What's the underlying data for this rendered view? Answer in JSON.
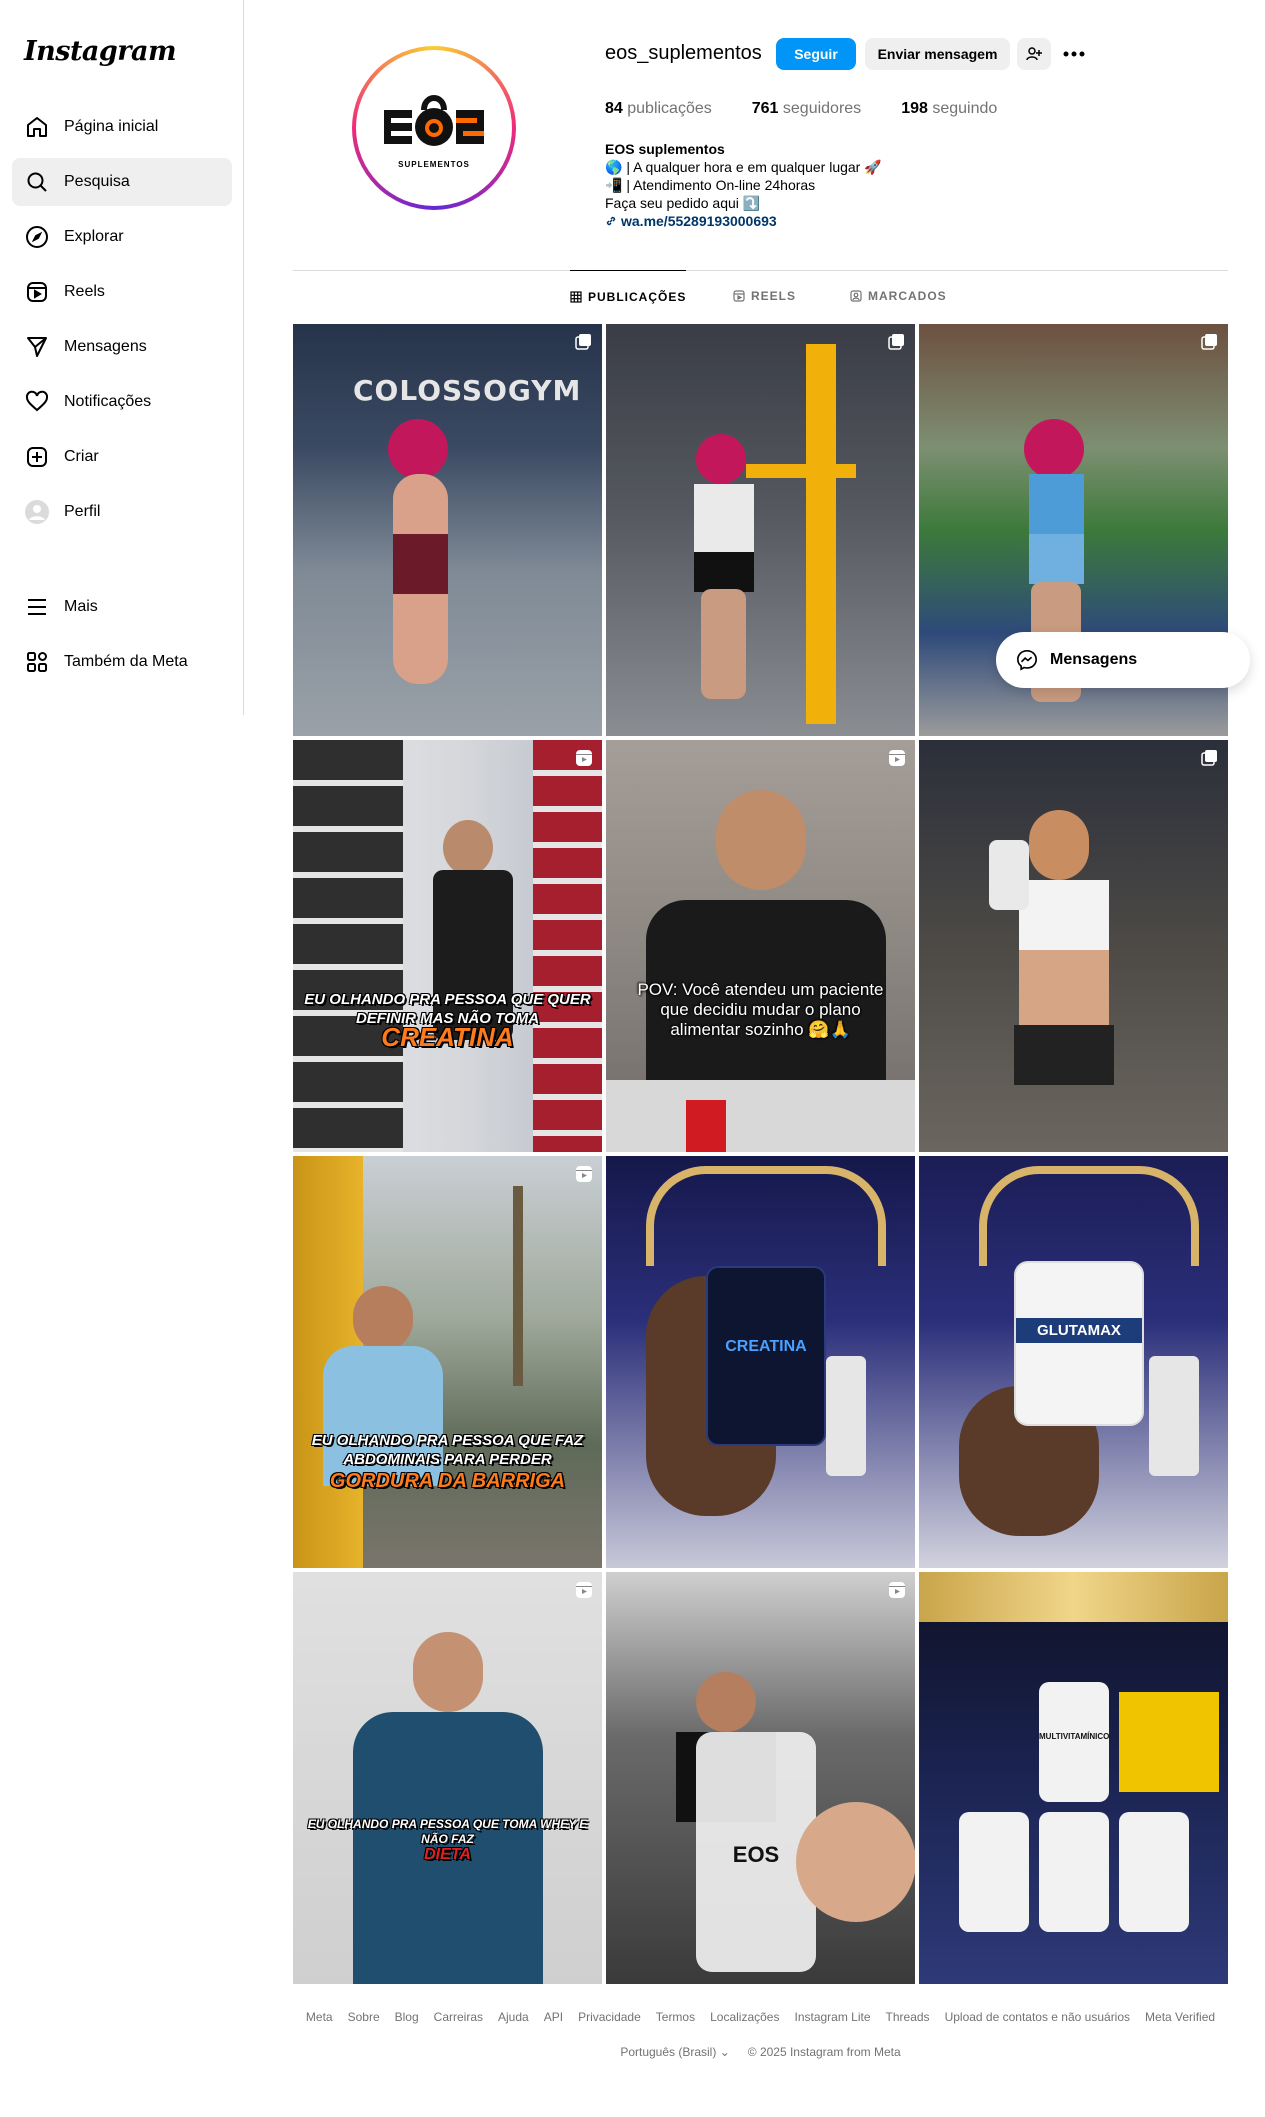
{
  "app": {
    "logo": "Instagram"
  },
  "sidebar": {
    "items": [
      {
        "label": "Página inicial",
        "icon": "home-icon"
      },
      {
        "label": "Pesquisa",
        "icon": "search-icon",
        "active": true
      },
      {
        "label": "Explorar",
        "icon": "compass-icon"
      },
      {
        "label": "Reels",
        "icon": "reels-icon"
      },
      {
        "label": "Mensagens",
        "icon": "send-icon"
      },
      {
        "label": "Notificações",
        "icon": "heart-icon"
      },
      {
        "label": "Criar",
        "icon": "plus-square-icon"
      },
      {
        "label": "Perfil",
        "icon": "avatar-icon"
      }
    ],
    "more": [
      {
        "label": "Mais",
        "icon": "menu-icon"
      },
      {
        "label": "Também da Meta",
        "icon": "meta-apps-icon"
      }
    ]
  },
  "profile": {
    "username": "eos_suplementos",
    "follow_label": "Seguir",
    "message_label": "Enviar mensagem",
    "avatar_brand": "EOS",
    "avatar_tagline": "SUPLEMENTOS",
    "stats": {
      "posts_count": "84",
      "posts_label": "publicações",
      "followers_count": "761",
      "followers_label": "seguidores",
      "following_count": "198",
      "following_label": "seguindo"
    },
    "bio": {
      "name": "EOS suplementos",
      "line1": "🌎 | A qualquer hora e em qualquer lugar 🚀",
      "line2": "📲 | Atendimento On-line 24horas",
      "line3": "Faça seu pedido aqui ⤵️",
      "link": "wa.me/55289193000693"
    }
  },
  "tabs": [
    {
      "label": "PUBLICAÇÕES",
      "icon": "grid-icon",
      "active": true
    },
    {
      "label": "REELS",
      "icon": "reels-icon"
    },
    {
      "label": "MARCADOS",
      "icon": "tagged-icon"
    }
  ],
  "posts": [
    {
      "type": "carousel",
      "bg": "#5b6c7d",
      "text": "COLOSSOGYM"
    },
    {
      "type": "carousel",
      "bg": "#4b4d55",
      "text": ""
    },
    {
      "type": "carousel",
      "bg": "#6c8a6c",
      "text": ""
    },
    {
      "type": "reel",
      "bg": "#c6c9cf",
      "overlay": "EU OLHANDO PRA PESSOA QUE QUER DEFINIR MAS NÃO TOMA",
      "accent": "CREATINA"
    },
    {
      "type": "reel",
      "bg": "#7c7470",
      "pov": "POV: Você atendeu um paciente que decidiu mudar o plano alimentar sozinho 🤗🙏"
    },
    {
      "type": "carousel",
      "bg": "#5e5852",
      "text": ""
    },
    {
      "type": "reel",
      "bg": "#7f8b6d",
      "overlay": "EU OLHANDO PRA PESSOA QUE FAZ ABDOMINAIS PARA PERDER",
      "accent": "GORDURA DA BARRIGA"
    },
    {
      "type": "none",
      "bg": "#2a2a6a",
      "product": "CREATINA"
    },
    {
      "type": "none",
      "bg": "#23235a",
      "product": "GLUTAMAX"
    },
    {
      "type": "reel",
      "bg": "#cfcfcf",
      "overlay": "EU OLHANDO PRA PESSOA QUE TOMA WHEY E NÃO FAZ",
      "accent": "DIETA"
    },
    {
      "type": "reel",
      "bg": "#4a4a4a",
      "product": "EOS"
    },
    {
      "type": "none",
      "bg": "#18203a",
      "product": "MULTIVITAMÍNICO"
    }
  ],
  "messages_pill": {
    "label": "Mensagens"
  },
  "footer": {
    "links": [
      "Meta",
      "Sobre",
      "Blog",
      "Carreiras",
      "Ajuda",
      "API",
      "Privacidade",
      "Termos",
      "Localizações",
      "Instagram Lite",
      "Threads",
      "Upload de contatos e não usuários",
      "Meta Verified"
    ],
    "language": "Português (Brasil)",
    "copyright": "© 2025 Instagram from Meta"
  }
}
